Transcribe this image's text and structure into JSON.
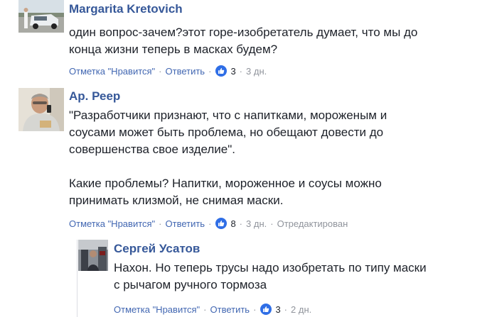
{
  "comments": [
    {
      "author": "Margarita Kretovich",
      "lines": [
        "один вопрос-зачем?этот горе-изобретатель думает, что мы до",
        "конца жизни теперь в масках будем?"
      ],
      "like_label": "Отметка \"Нравится\"",
      "reply_label": "Ответить",
      "likes": "3",
      "time": "3 дн."
    },
    {
      "author": "Ар. Реер",
      "lines": [
        "\"Разработчики признают, что с напитками, мороженым и",
        "соусами может быть проблема, но обещают довести до",
        "совершенства свое изделие\".",
        "",
        "Какие проблемы? Напитки, мороженное и соусы можно",
        "принимать клизмой, не снимая маски."
      ],
      "like_label": "Отметка \"Нравится\"",
      "reply_label": "Ответить",
      "likes": "8",
      "time": "3 дн.",
      "edited": "Отредактирован"
    },
    {
      "author": "Сергей Усатов",
      "lines": [
        "Нахон. Но теперь трусы надо изобретать по типу маски",
        "с рычагом ручного тормоза"
      ],
      "like_label": "Отметка \"Нравится\"",
      "reply_label": "Ответить",
      "likes": "3",
      "time": "2 дн."
    }
  ],
  "separator": "·",
  "colors": {
    "author": "#365899",
    "link": "#4267b2",
    "meta": "#90949c",
    "like_badge": "#2f6ee6"
  },
  "icons": {
    "like": "thumbs-up-icon"
  }
}
